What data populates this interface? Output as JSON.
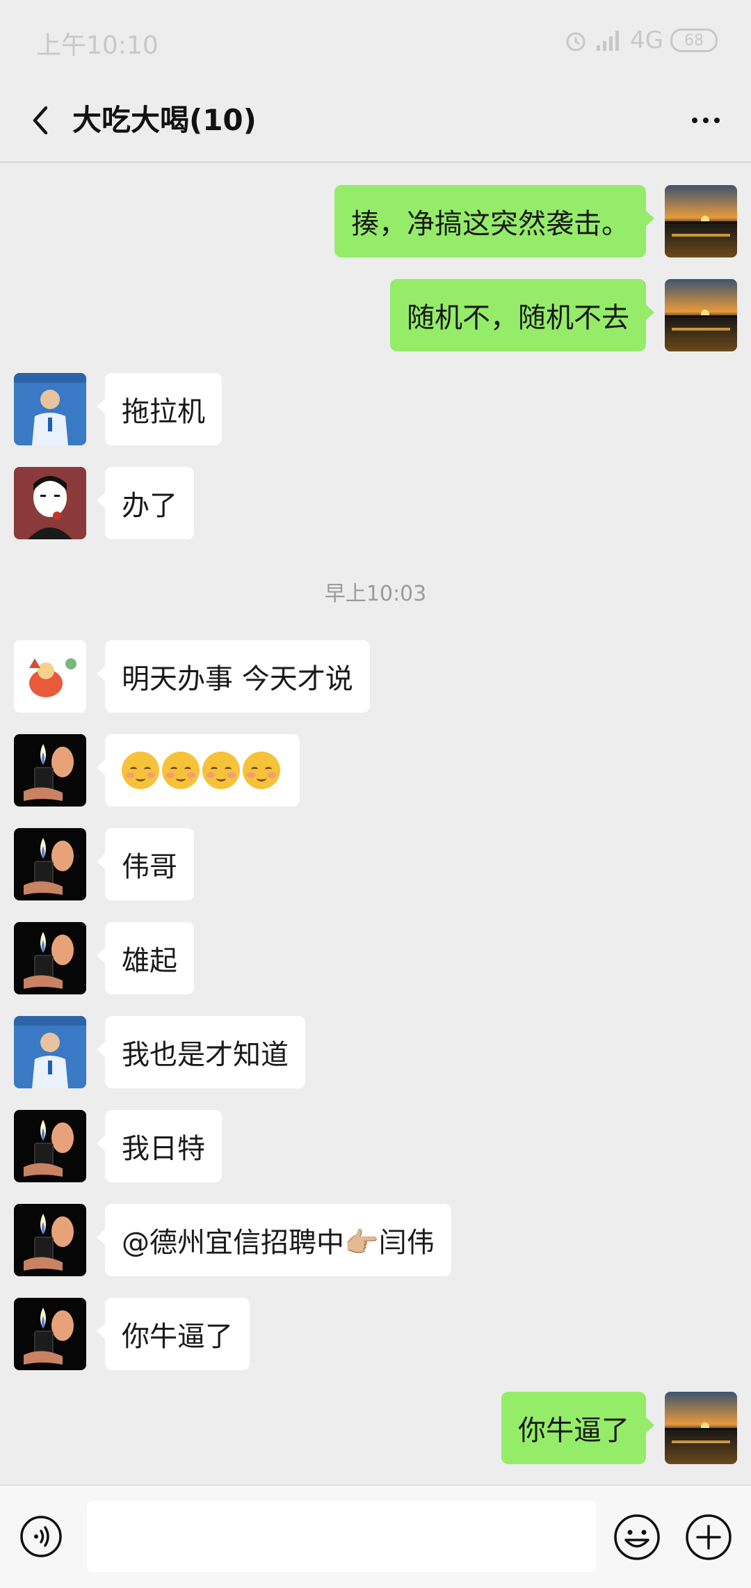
{
  "status_bar": {
    "time": "上午10:10",
    "network": "4G",
    "battery": "68"
  },
  "header": {
    "title": "大吃大喝(10)"
  },
  "timestamp": "早上10:03",
  "messages": [
    {
      "side": "right",
      "avatar": "sunset",
      "text": "揍，净搞这突然袭击。"
    },
    {
      "side": "right",
      "avatar": "sunset",
      "text": "随机不，随机不去"
    },
    {
      "side": "left",
      "avatar": "man-badge",
      "text": "拖拉机"
    },
    {
      "side": "left",
      "avatar": "cartoon-man",
      "text": "办了"
    },
    {
      "side": "left",
      "avatar": "red-cartoon",
      "text": "明天办事 今天才说"
    },
    {
      "side": "left",
      "avatar": "lighter",
      "text": "",
      "emoji_count": 4
    },
    {
      "side": "left",
      "avatar": "lighter",
      "text": "伟哥"
    },
    {
      "side": "left",
      "avatar": "lighter",
      "text": "雄起"
    },
    {
      "side": "left",
      "avatar": "man-badge",
      "text": "我也是才知道"
    },
    {
      "side": "left",
      "avatar": "lighter",
      "text": "我日特"
    },
    {
      "side": "left",
      "avatar": "lighter",
      "text": "@德州宜信招聘中👉🏼闫伟"
    },
    {
      "side": "left",
      "avatar": "lighter",
      "text": "你牛逼了"
    },
    {
      "side": "right",
      "avatar": "sunset",
      "text": "你牛逼了"
    }
  ],
  "input": {
    "placeholder": ""
  },
  "colors": {
    "background": "#ededed",
    "sent_bubble": "#95ec69",
    "received_bubble": "#ffffff",
    "header_text": "#111111",
    "timestamp": "#9b9b9b"
  }
}
